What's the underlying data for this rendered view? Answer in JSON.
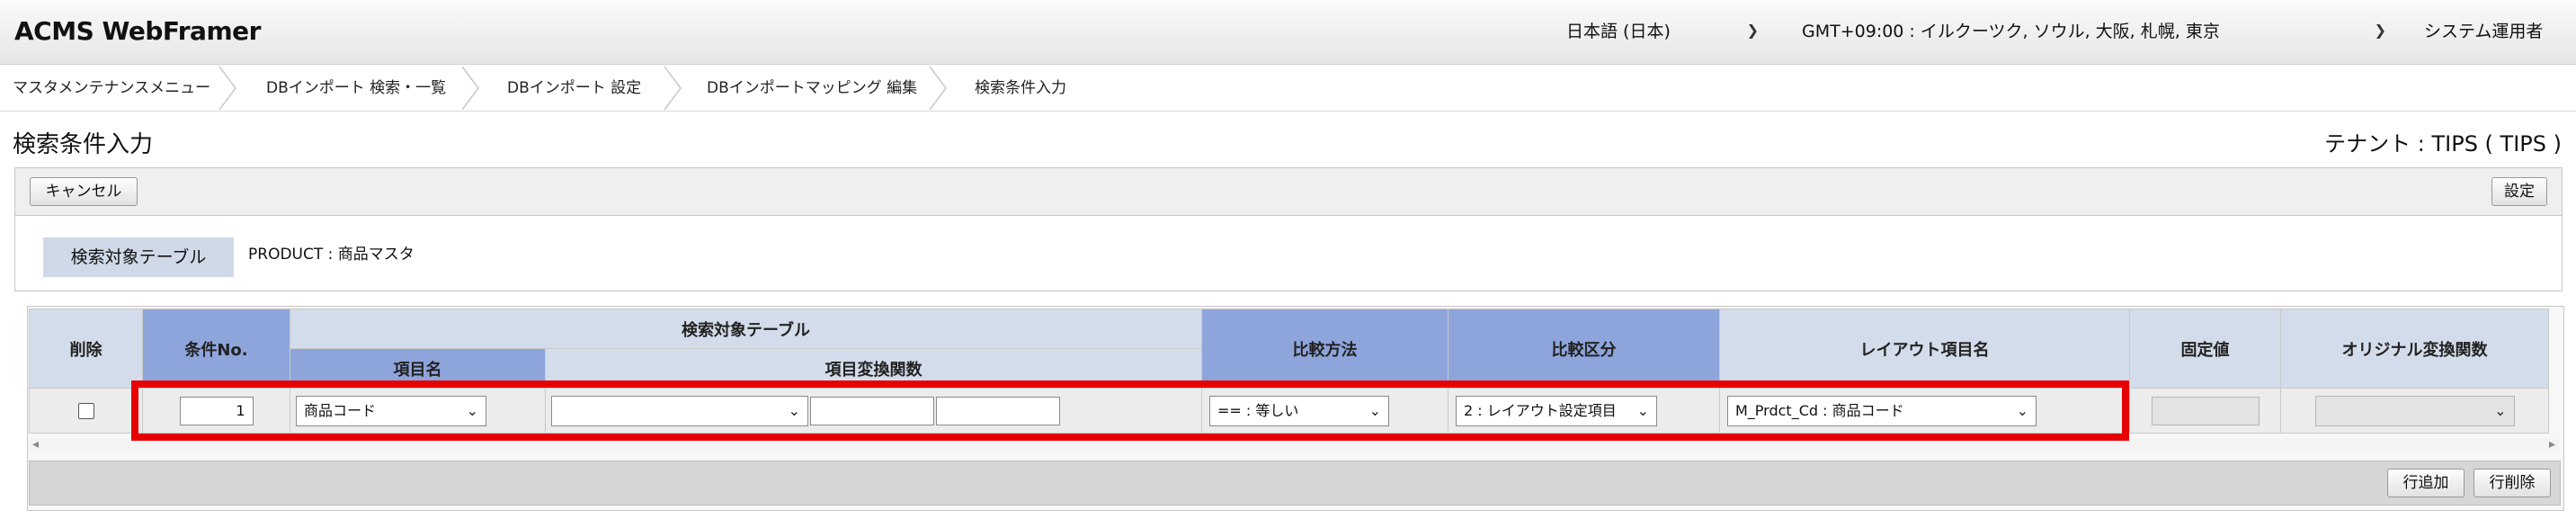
{
  "header": {
    "logo": "ACMS WebFramer",
    "language": "日本語 (日本)",
    "timezone": "GMT+09:00 : イルクーツク, ソウル, 大阪, 札幌, 東京",
    "role": "システム運用者"
  },
  "breadcrumb": [
    "マスタメンテナンスメニュー",
    "DBインポート 検索・一覧",
    "DBインポート 設定",
    "DBインポートマッピング 編集",
    "検索条件入力"
  ],
  "page": {
    "title": "検索条件入力",
    "tenant": "テナント : TIPS ( TIPS )"
  },
  "toolbar": {
    "cancel_label": "キャンセル",
    "settings_label": "設定"
  },
  "target": {
    "label": "検索対象テーブル",
    "value": "PRODUCT : 商品マスタ"
  },
  "grid": {
    "headers": {
      "delete": "削除",
      "condition_no": "条件No.",
      "search_table": "検索対象テーブル",
      "item_name": "項目名",
      "item_func": "項目変換関数",
      "compare_method": "比較方法",
      "compare_type": "比較区分",
      "layout_item": "レイアウト項目名",
      "fixed_value": "固定値",
      "original_func": "オリジナル変換関数"
    },
    "rows": [
      {
        "deleted": false,
        "condition_no": "1",
        "item_name": "商品コード",
        "item_func": "",
        "func_arg1": "",
        "func_arg2": "",
        "compare_method": "== : 等しい",
        "compare_type": "2 : レイアウト設定項目",
        "layout_item": "M_Prdct_Cd : 商品コード",
        "fixed_value": "",
        "original_func": ""
      }
    ]
  },
  "bottom_toolbar": {
    "add_row_label": "行追加",
    "delete_row_label": "行削除"
  },
  "colors": {
    "highlight": "#e60000",
    "header_blue": "#8ea5dc",
    "header_light": "#d3dcea"
  }
}
